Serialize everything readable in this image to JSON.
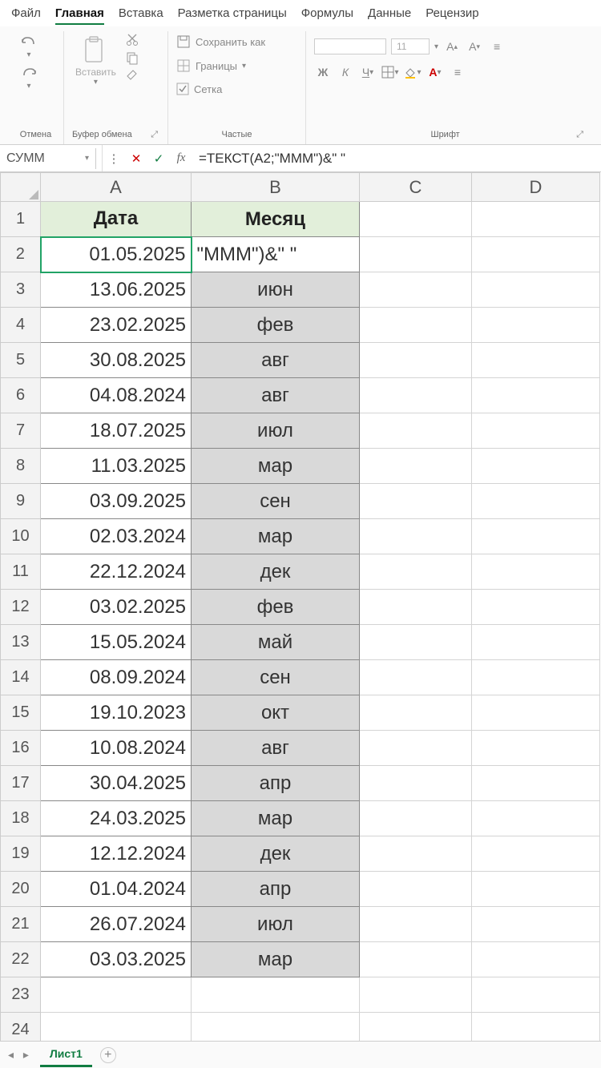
{
  "menu": {
    "items": [
      "Файл",
      "Главная",
      "Вставка",
      "Разметка страницы",
      "Формулы",
      "Данные",
      "Рецензир"
    ],
    "active_index": 1
  },
  "ribbon": {
    "undo_group": "Отмена",
    "clipboard_group": "Буфер обмена",
    "paste_label": "Вставить",
    "frequent_group": "Частые",
    "save_as": "Сохранить как",
    "borders": "Границы",
    "grid": "Сетка",
    "font_group": "Шрифт",
    "font_size": "11",
    "bold": "Ж",
    "italic": "К",
    "underline": "Ч"
  },
  "formula_bar": {
    "name": "СУММ",
    "formula": "=ТЕКСТ(A2;\"МММ\")&\" \""
  },
  "columns": [
    "A",
    "B",
    "C",
    "D"
  ],
  "headers": {
    "A": "Дата",
    "B": "Месяц"
  },
  "rows": [
    {
      "n": 1,
      "A": "Дата",
      "B": "Месяц",
      "is_header": true
    },
    {
      "n": 2,
      "A": "01.05.2025",
      "B": "\"МММ\")&\" \"",
      "editing": true
    },
    {
      "n": 3,
      "A": "13.06.2025",
      "B": "июн"
    },
    {
      "n": 4,
      "A": "23.02.2025",
      "B": "фев"
    },
    {
      "n": 5,
      "A": "30.08.2025",
      "B": "авг"
    },
    {
      "n": 6,
      "A": "04.08.2024",
      "B": "авг"
    },
    {
      "n": 7,
      "A": "18.07.2025",
      "B": "июл"
    },
    {
      "n": 8,
      "A": "11.03.2025",
      "B": "мар"
    },
    {
      "n": 9,
      "A": "03.09.2025",
      "B": "сен"
    },
    {
      "n": 10,
      "A": "02.03.2024",
      "B": "мар"
    },
    {
      "n": 11,
      "A": "22.12.2024",
      "B": "дек"
    },
    {
      "n": 12,
      "A": "03.02.2025",
      "B": "фев"
    },
    {
      "n": 13,
      "A": "15.05.2024",
      "B": "май"
    },
    {
      "n": 14,
      "A": "08.09.2024",
      "B": "сен"
    },
    {
      "n": 15,
      "A": "19.10.2023",
      "B": "окт"
    },
    {
      "n": 16,
      "A": "10.08.2024",
      "B": "авг"
    },
    {
      "n": 17,
      "A": "30.04.2025",
      "B": "апр"
    },
    {
      "n": 18,
      "A": "24.03.2025",
      "B": "мар"
    },
    {
      "n": 19,
      "A": "12.12.2024",
      "B": "дек"
    },
    {
      "n": 20,
      "A": "01.04.2024",
      "B": "апр"
    },
    {
      "n": 21,
      "A": "26.07.2024",
      "B": "июл"
    },
    {
      "n": 22,
      "A": "03.03.2025",
      "B": "мар"
    },
    {
      "n": 23,
      "A": "",
      "B": ""
    },
    {
      "n": 24,
      "A": "",
      "B": ""
    }
  ],
  "sheet": {
    "name": "Лист1"
  }
}
